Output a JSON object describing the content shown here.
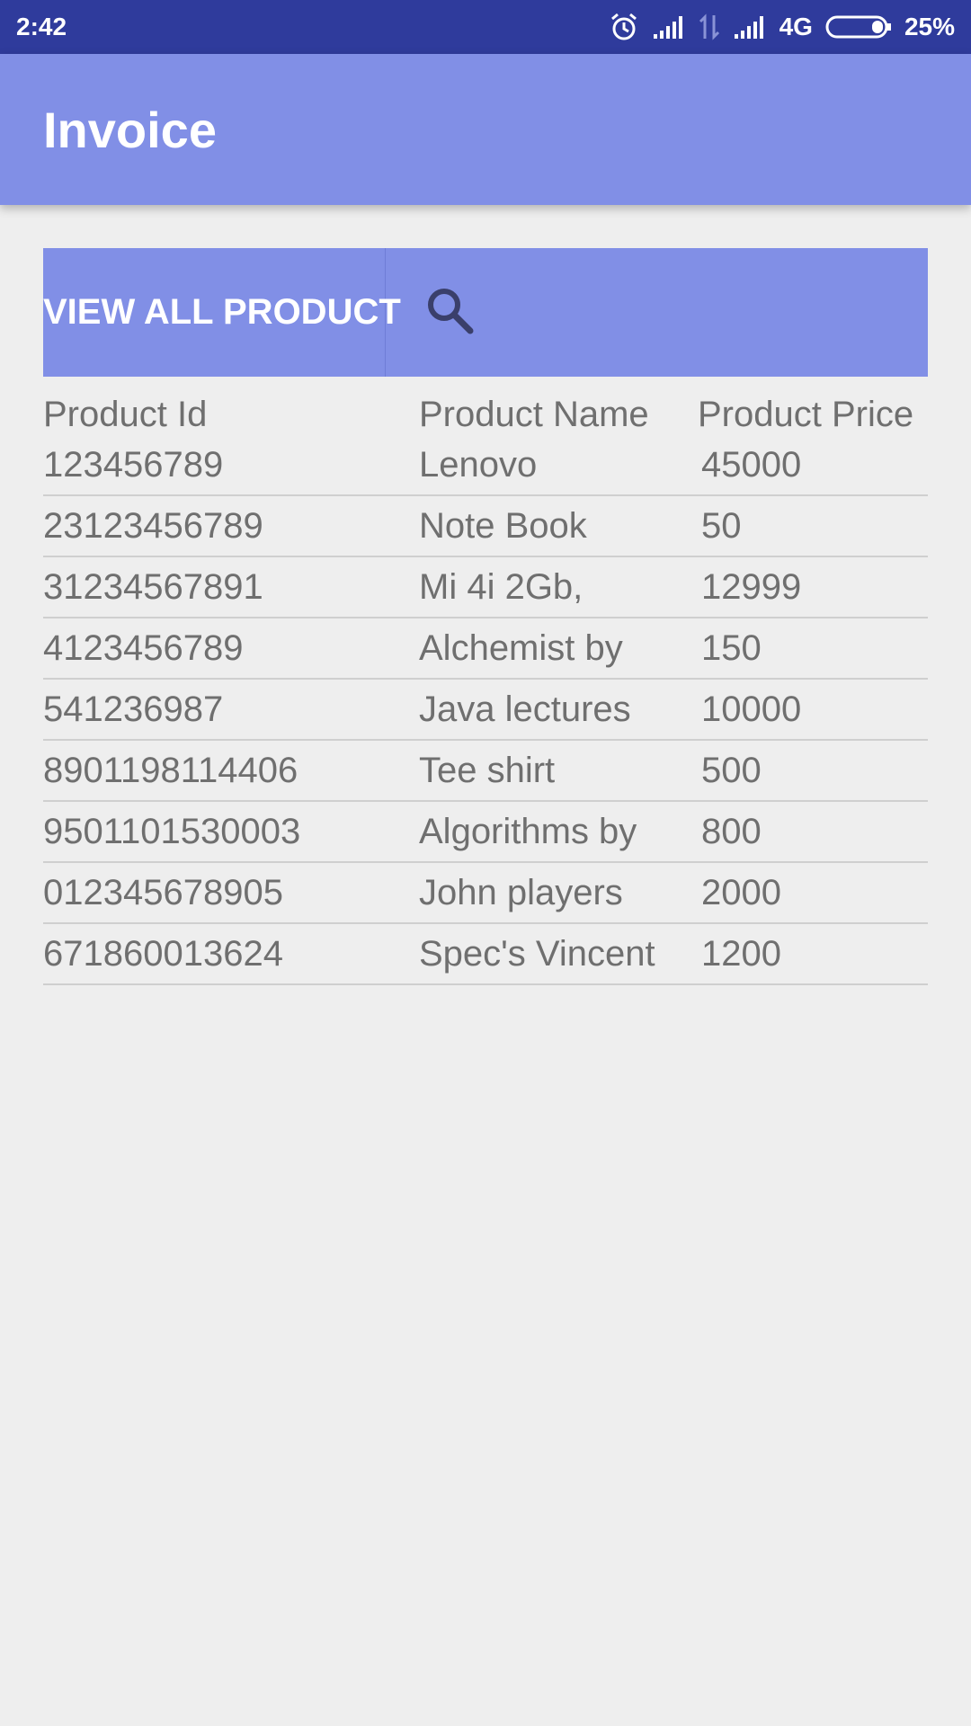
{
  "status_bar": {
    "time": "2:42",
    "network": "4G",
    "battery": "25%",
    "icons": [
      "alarm-icon",
      "signal-icon",
      "data-arrows-icon",
      "signal-icon",
      "battery-icon"
    ]
  },
  "app_bar": {
    "title": "Invoice"
  },
  "actions": {
    "view_all_label": "VIEW ALL PRODUCT",
    "search_icon": "search-icon"
  },
  "table": {
    "headers": {
      "id": "Product Id",
      "name": "Product Name",
      "price": "Product Price"
    },
    "rows": [
      {
        "id": "123456789",
        "name": "Lenovo",
        "price": "45000"
      },
      {
        "id": "23123456789",
        "name": "Note Book",
        "price": "50"
      },
      {
        "id": "31234567891",
        "name": "Mi 4i 2Gb,",
        "price": "12999"
      },
      {
        "id": "4123456789",
        "name": "Alchemist by",
        "price": "150"
      },
      {
        "id": "541236987",
        "name": "Java lectures",
        "price": "10000"
      },
      {
        "id": "8901198114406",
        "name": "Tee shirt",
        "price": "500"
      },
      {
        "id": "9501101530003",
        "name": "Algorithms by",
        "price": "800"
      },
      {
        "id": "012345678905",
        "name": "John players",
        "price": "2000"
      },
      {
        "id": "671860013624",
        "name": "Spec's Vincent",
        "price": "1200"
      }
    ]
  },
  "colors": {
    "status_bar": "#2f3b9c",
    "primary": "#818fe6",
    "background": "#eeeeee",
    "text": "#6f6f6f"
  }
}
